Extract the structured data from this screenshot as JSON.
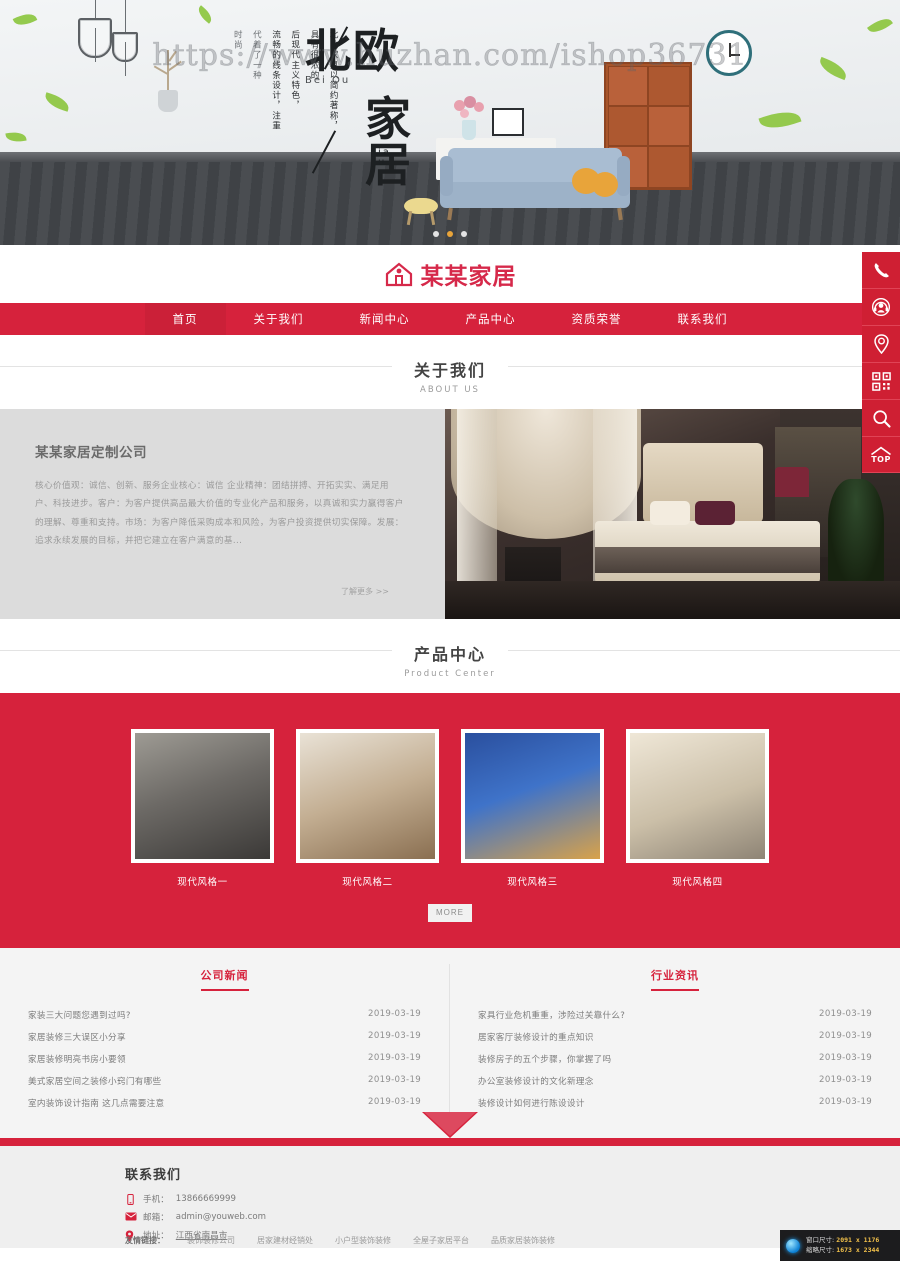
{
  "banner": {
    "title_cn_1": "北欧",
    "title_pinyin_1": "Bei Ou",
    "title_cn_2": "家居",
    "title_pinyin_2": "Jia Ju",
    "vertical_columns": [
      "北欧家具以简约著称，",
      "具有很浓的",
      "后现代主义特色，",
      "流畅的线条设计，注重",
      "代着了一种",
      "时尚"
    ],
    "watermark": "https://www.huzhan.com/ishop36731",
    "dots": [
      "dot-1",
      "dot-2",
      "dot-3"
    ],
    "active_dot": 1
  },
  "header": {
    "logo_text": "某某家居",
    "logo_icon": "house-icon"
  },
  "nav": {
    "items": [
      {
        "label": "首页",
        "active": true
      },
      {
        "label": "关于我们",
        "active": false
      },
      {
        "label": "新闻中心",
        "active": false
      },
      {
        "label": "产品中心",
        "active": false
      },
      {
        "label": "资质荣誉",
        "active": false
      },
      {
        "label": "联系我们",
        "active": false
      }
    ]
  },
  "about": {
    "section_title": "关于我们",
    "section_en": "ABOUT US",
    "heading": "某某家居定制公司",
    "body": "核心价值观：诚信、创新、服务企业核心：诚信 企业精神：团结拼搏、开拓实实、满足用户、科技进步。客户：为客户提供高品最大价值的专业化产品和服务，以真诚和实力赢得客户的理解、尊重和支持。市场：为客户降低采购成本和风险，为客户投资提供切实保障。发展：追求永续发展的目标，并把它建立在客户满意的基...",
    "more": "了解更多 >>"
  },
  "products": {
    "section_title": "产品中心",
    "section_en": "Product Center",
    "items": [
      {
        "name": "现代风格一",
        "thumb": "living-room-grey"
      },
      {
        "name": "现代风格二",
        "thumb": "bedroom-warm"
      },
      {
        "name": "现代风格三",
        "thumb": "bedroom-blue-mural"
      },
      {
        "name": "现代风格四",
        "thumb": "living-room-light"
      }
    ],
    "more_button": "MORE"
  },
  "news": {
    "company": {
      "tab_label": "公司新闻",
      "items": [
        {
          "title": "家装三大问题您遇到过吗?",
          "date": "2019-03-19"
        },
        {
          "title": "家居装修三大误区小分享",
          "date": "2019-03-19"
        },
        {
          "title": "家居装修明亮书房小要领",
          "date": "2019-03-19"
        },
        {
          "title": "美式家居空间之装修小窍门有哪些",
          "date": "2019-03-19"
        },
        {
          "title": "室内装饰设计指南 这几点需要注意",
          "date": "2019-03-19"
        }
      ]
    },
    "industry": {
      "tab_label": "行业资讯",
      "items": [
        {
          "title": "家具行业危机重重，涉险过关靠什么?",
          "date": "2019-03-19"
        },
        {
          "title": "居家客厅装修设计的重点知识",
          "date": "2019-03-19"
        },
        {
          "title": "装修房子的五个步骤，你掌握了吗",
          "date": "2019-03-19"
        },
        {
          "title": "办公室装修设计的文化新理念",
          "date": "2019-03-19"
        },
        {
          "title": "装修设计如何进行陈设设计",
          "date": "2019-03-19"
        }
      ]
    }
  },
  "footer": {
    "heading": "联系我们",
    "contacts": [
      {
        "icon": "phone-icon",
        "label": "手机：",
        "value": "13866669999"
      },
      {
        "icon": "mail-icon",
        "label": "邮箱：",
        "value": "admin@youweb.com"
      },
      {
        "icon": "location-icon",
        "label": "地址：",
        "value": "江西省南昌市"
      }
    ],
    "links_label": "友情链接：",
    "links": [
      "装饰装修公司",
      "居家建材经销处",
      "小户型装饰装修",
      "全屋子家居平台",
      "品质家居装饰装修"
    ]
  },
  "sidebar": {
    "items": [
      {
        "icon": "phone-icon",
        "name": "telephone"
      },
      {
        "icon": "headset-icon",
        "name": "online-service"
      },
      {
        "icon": "location-pin-icon",
        "name": "map-location"
      },
      {
        "icon": "qrcode-icon",
        "name": "qr-code"
      },
      {
        "icon": "search-icon",
        "name": "search"
      },
      {
        "icon": "chevron-up-icon",
        "name": "back-to-top",
        "label": "TOP"
      }
    ]
  },
  "screen_info": {
    "window_label": "窗口尺寸:",
    "window_value": "2091 x 1176",
    "thumb_label": "缩略尺寸:",
    "thumb_value": "1673 x 2344"
  },
  "colors": {
    "brand_red": "#d6223c",
    "sidebar_red": "#cf1f33",
    "grey_panel": "#dcdcdc",
    "light_panel": "#f4f4f4"
  }
}
